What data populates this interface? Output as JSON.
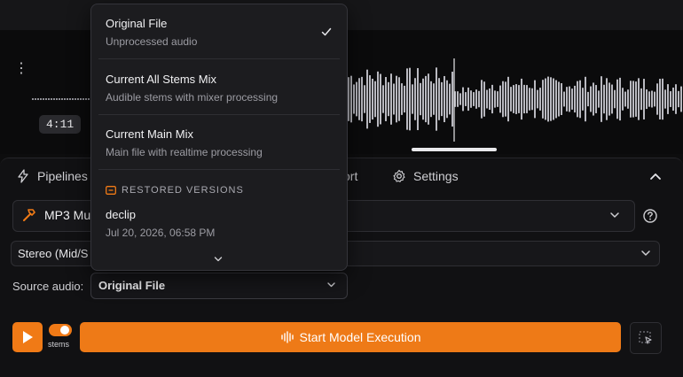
{
  "waveform": {
    "time": "4:11"
  },
  "tabs": [
    {
      "label": "Pipelines"
    },
    {
      "label": "ort"
    },
    {
      "label": "Settings"
    }
  ],
  "pipeline": {
    "label": "MP3 Mu"
  },
  "mode": {
    "label": "Stereo (Mid/S"
  },
  "source": {
    "label": "Source audio:",
    "value": "Original File"
  },
  "toggle": {
    "label": "stems"
  },
  "actions": {
    "start": "Start Model Execution"
  },
  "dropdown": {
    "items": [
      {
        "title": "Original File",
        "subtitle": "Unprocessed audio",
        "selected": true
      },
      {
        "title": "Current All Stems Mix",
        "subtitle": "Audible stems with mixer processing",
        "selected": false
      },
      {
        "title": "Current Main Mix",
        "subtitle": "Main file with realtime processing",
        "selected": false
      }
    ],
    "restored_header": "RESTORED VERSIONS",
    "restored": [
      {
        "title": "declip",
        "subtitle": "Jul 20, 2026, 06:58 PM"
      }
    ]
  },
  "colors": {
    "accent": "#f07a16",
    "background": "#0d0d0e",
    "panel": "#111113"
  }
}
